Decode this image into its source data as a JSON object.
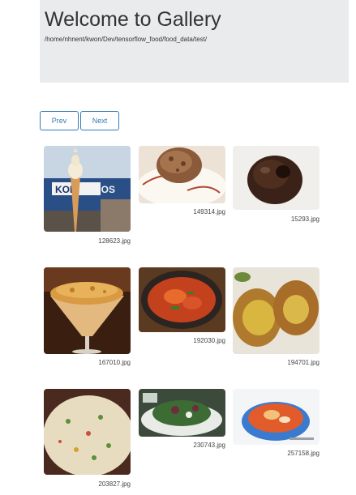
{
  "header": {
    "title": "Welcome to Gallery",
    "path": "/home/nhnent/kwon/Dev/tensorflow_food/food_data/test/"
  },
  "pagination": {
    "prev_label": "Prev",
    "next_label": "Next"
  },
  "gallery": [
    {
      "filename": "128623.jpg",
      "icon": "soft-serve-cone-photo"
    },
    {
      "filename": "149314.jpg",
      "icon": "pastry-on-plate-photo"
    },
    {
      "filename": "15293.jpg",
      "icon": "chocolate-donut-photo"
    },
    {
      "filename": "167010.jpg",
      "icon": "crumble-dessert-glass-photo"
    },
    {
      "filename": "192030.jpg",
      "icon": "stew-skillet-photo"
    },
    {
      "filename": "194701.jpg",
      "icon": "fried-pastries-photo"
    },
    {
      "filename": "203827.jpg",
      "icon": "fried-rice-photo"
    },
    {
      "filename": "230743.jpg",
      "icon": "salad-plate-photo"
    },
    {
      "filename": "257158.jpg",
      "icon": "soup-bowl-photo"
    }
  ]
}
